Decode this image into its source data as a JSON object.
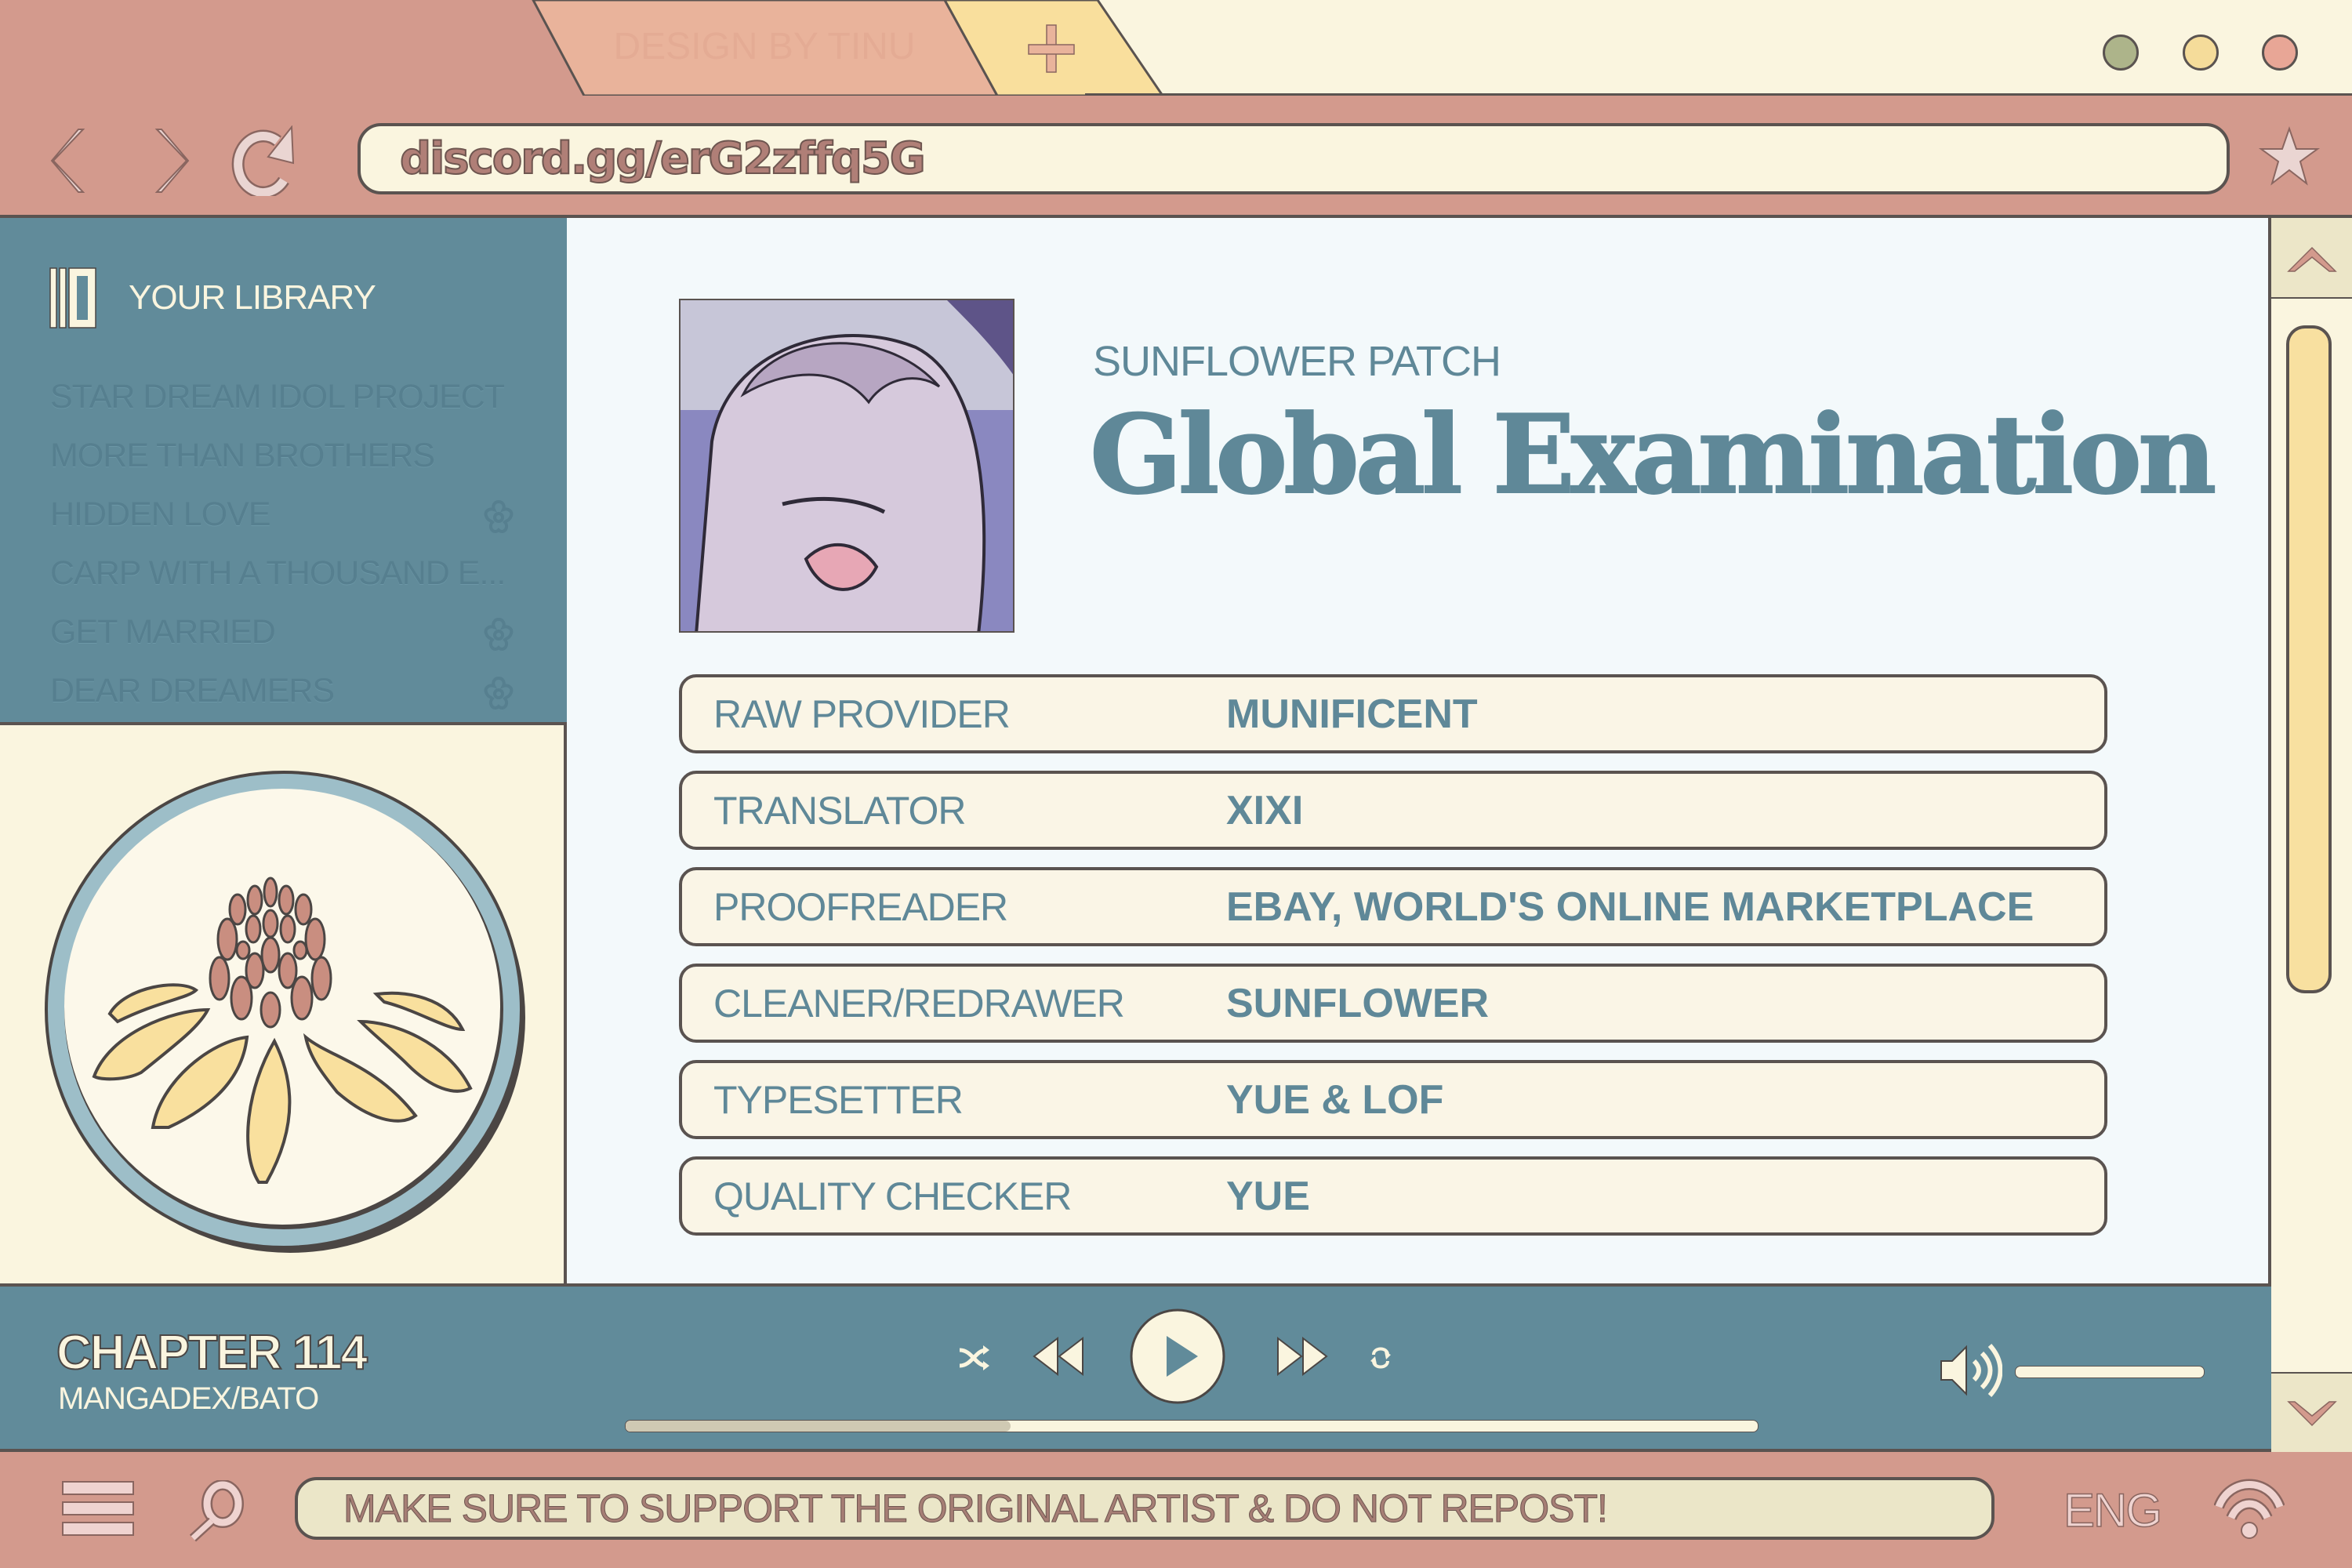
{
  "browser": {
    "tabs": [
      {
        "label": "DESIGN BY TINU",
        "color": "#e9b39b"
      },
      {
        "label": "+",
        "color": "#f9df9d"
      }
    ],
    "window_controls": [
      {
        "name": "minimize",
        "color": "#adb48a"
      },
      {
        "name": "maximize",
        "color": "#f5dc9a"
      },
      {
        "name": "close",
        "color": "#e8a696"
      }
    ],
    "nav_icons": [
      "back-icon",
      "forward-icon",
      "reload-icon"
    ],
    "url": "discord.gg/erG2zffq5G",
    "bookmark_icon": "star-icon"
  },
  "sidebar": {
    "title": "YOUR LIBRARY",
    "title_icon": "library-icon",
    "items": [
      {
        "label": "STAR DREAM IDOL PROJECT",
        "flower": false
      },
      {
        "label": "MORE THAN BROTHERS",
        "flower": false
      },
      {
        "label": "HIDDEN LOVE",
        "flower": true
      },
      {
        "label": "CARP WITH A THOUSAND E...",
        "flower": false
      },
      {
        "label": "GET MARRIED",
        "flower": true
      },
      {
        "label": "DEAR DREAMERS",
        "flower": true
      }
    ],
    "logo": "sunflower-logo"
  },
  "main": {
    "group": "SUNFLOWER PATCH",
    "title": "Global Examination",
    "credits": [
      {
        "role": "RAW PROVIDER",
        "name": "MUNIFICENT"
      },
      {
        "role": "TRANSLATOR",
        "name": "XIXI"
      },
      {
        "role": "PROOFREADER",
        "name": "EBAY, WORLD'S ONLINE MARKETPLACE"
      },
      {
        "role": "CLEANER/REDRAWER",
        "name": "SUNFLOWER"
      },
      {
        "role": "TYPESETTER",
        "name": "YUE & LOF"
      },
      {
        "role": "QUALITY CHECKER",
        "name": "YUE"
      }
    ]
  },
  "player": {
    "chapter": "CHAPTER 114",
    "source": "MANGADEX/BATO",
    "progress": 0.34,
    "volume": 1.0
  },
  "footer": {
    "notice": "MAKE SURE TO SUPPORT THE ORIGINAL ARTIST & DO NOT REPOST!",
    "language": "ENG"
  },
  "colors": {
    "pink": "#d39a8d",
    "teal": "#618b9a",
    "cream": "#faf5df",
    "yellow": "#f8e0a0",
    "outline": "#5a5350"
  }
}
